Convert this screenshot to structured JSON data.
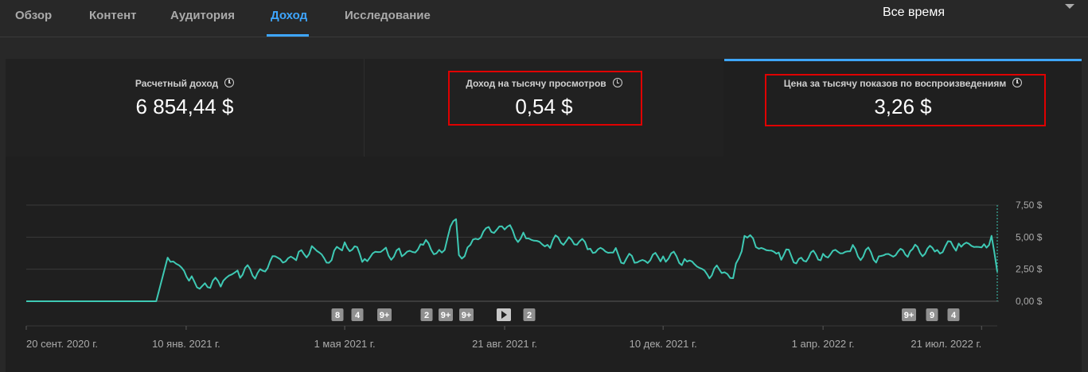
{
  "tabs": [
    {
      "label": "Обзор",
      "active": false
    },
    {
      "label": "Контент",
      "active": false
    },
    {
      "label": "Аудитория",
      "active": false
    },
    {
      "label": "Доход",
      "active": true
    },
    {
      "label": "Исследование",
      "active": false
    }
  ],
  "period": "Все время",
  "metrics": [
    {
      "label": "Расчетный доход",
      "value": "6 854,44 $"
    },
    {
      "label": "Доход на тысячу просмотров",
      "value": "0,54 $"
    },
    {
      "label": "Цена за тысячу показов по воспроизведениям",
      "value": "3,26 $"
    }
  ],
  "colors": {
    "accent": "#3ea6ff",
    "line": "#3ec9b4",
    "highlight": "#e00000"
  },
  "chart_data": {
    "type": "line",
    "series": [
      {
        "x": [
          "2020-09-20",
          "2020-12-20",
          "2020-12-28",
          "2021-01-01",
          "2021-01-05",
          "2021-01-12",
          "2021-01-25",
          "2021-02-05",
          "2021-02-15",
          "2021-03-01",
          "2021-03-15",
          "2021-03-28",
          "2021-04-08",
          "2021-04-20",
          "2021-05-01",
          "2021-05-15",
          "2021-05-28",
          "2021-06-10",
          "2021-06-25",
          "2021-07-08",
          "2021-07-18",
          "2021-07-20",
          "2021-07-28",
          "2021-08-08",
          "2021-08-21",
          "2021-09-05",
          "2021-09-20",
          "2021-10-05",
          "2021-10-20",
          "2021-11-05",
          "2021-11-20",
          "2021-12-01",
          "2021-12-10",
          "2021-12-25",
          "2022-01-08",
          "2022-01-20",
          "2022-01-28",
          "2022-02-05",
          "2022-02-15",
          "2022-03-01",
          "2022-03-15",
          "2022-04-01",
          "2022-04-20",
          "2022-05-10",
          "2022-06-01",
          "2022-06-20",
          "2022-07-05",
          "2022-07-21",
          "2022-07-28",
          "2022-08-01"
        ],
        "y": [
          0,
          0,
          3.4,
          3.1,
          2.8,
          1.6,
          1.1,
          1.6,
          2.4,
          2.2,
          3.4,
          3.2,
          4.3,
          3.0,
          4.6,
          3.3,
          4.0,
          3.5,
          4.4,
          3.8,
          6.4,
          3.6,
          4.4,
          5.7,
          5.6,
          4.9,
          4.4,
          5.0,
          4.1,
          3.8,
          3.0,
          3.2,
          3.5,
          3.3,
          2.4,
          2.2,
          1.8,
          5.1,
          4.1,
          3.8,
          3.3,
          3.7,
          3.9,
          3.5,
          3.9,
          4.0,
          4.5,
          4.2,
          5.1,
          2.3
        ]
      }
    ],
    "xticks": [
      "20 сент. 2020 г.",
      "10 янв. 2021 г.",
      "1 мая 2021 г.",
      "21 авг. 2021 г.",
      "10 дек. 2021 г.",
      "1 апр. 2022 г.",
      "21 июл. 2022 г."
    ],
    "yticks": [
      "0,00 $",
      "2,50 $",
      "5,00 $",
      "7,50 $"
    ],
    "ylim": [
      0,
      7.5
    ],
    "annotations": [
      "8",
      "4",
      "9+",
      "2",
      "9+",
      "9+",
      "play-icon",
      "2",
      "9+",
      "9",
      "4"
    ]
  }
}
